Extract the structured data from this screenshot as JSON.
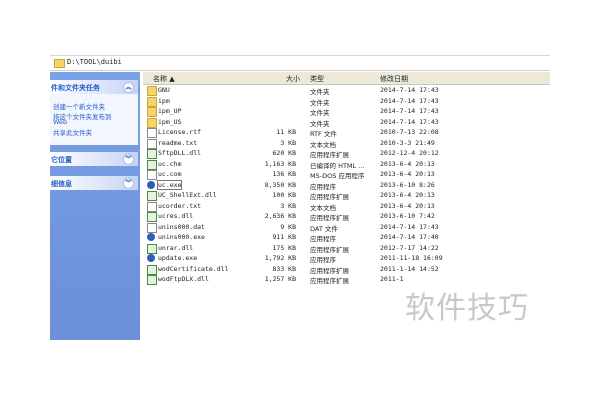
{
  "address": {
    "path": "D:\\TOOL\\duibi"
  },
  "left_panel": {
    "sections": [
      {
        "title": "件和文件夹任务",
        "items": [
          "创建一个新文件夹",
          "将这个文件夹发布到",
          "Web",
          "共享此文件夹"
        ]
      },
      {
        "title": "它位置",
        "items": []
      },
      {
        "title": "细信息",
        "items": []
      }
    ]
  },
  "columns": {
    "name": "名称 ▲",
    "size": "大小",
    "type": "类型",
    "date": "修改日期"
  },
  "files": [
    {
      "name": "GNU",
      "size": "",
      "type": "文件夹",
      "date": "2014-7-14 17:43",
      "icon": "folder"
    },
    {
      "name": "ipm",
      "size": "",
      "type": "文件夹",
      "date": "2014-7-14 17:43",
      "icon": "folder"
    },
    {
      "name": "ipm_UP",
      "size": "",
      "type": "文件夹",
      "date": "2014-7-14 17:43",
      "icon": "folder"
    },
    {
      "name": "ipm_US",
      "size": "",
      "type": "文件夹",
      "date": "2014-7-14 17:43",
      "icon": "folder"
    },
    {
      "name": "License.rtf",
      "size": "11 KB",
      "type": "RTF 文件",
      "date": "2010-7-13 22:08",
      "icon": "file"
    },
    {
      "name": "readme.txt",
      "size": "3 KB",
      "type": "文本文档",
      "date": "2010-3-3 21:49",
      "icon": "file"
    },
    {
      "name": "SftpDLL.dll",
      "size": "620 KB",
      "type": "应用程序扩展",
      "date": "2012-12-4 20:12",
      "icon": "dll"
    },
    {
      "name": "uc.chm",
      "size": "1,163 KB",
      "type": "已编译的 HTML ...",
      "date": "2013-6-4 20:13",
      "icon": "dll"
    },
    {
      "name": "uc.com",
      "size": "136 KB",
      "type": "MS-DOS 应用程序",
      "date": "2013-6-4 20:13",
      "icon": "file"
    },
    {
      "name": "uc.exe",
      "size": "8,350 KB",
      "type": "应用程序",
      "date": "2013-6-10 8:26",
      "icon": "exe"
    },
    {
      "name": "UC_ShellExt.dll",
      "size": "100 KB",
      "type": "应用程序扩展",
      "date": "2013-6-4 20:13",
      "icon": "dll"
    },
    {
      "name": "ucorder.txt",
      "size": "3 KB",
      "type": "文本文档",
      "date": "2013-6-4 20:13",
      "icon": "file"
    },
    {
      "name": "ucres.dll",
      "size": "2,636 KB",
      "type": "应用程序扩展",
      "date": "2013-6-10 7:42",
      "icon": "dll"
    },
    {
      "name": "unins000.dat",
      "size": "9 KB",
      "type": "DAT 文件",
      "date": "2014-7-14 17:43",
      "icon": "file"
    },
    {
      "name": "unins000.exe",
      "size": "911 KB",
      "type": "应用程序",
      "date": "2014-7-14 17:40",
      "icon": "exe"
    },
    {
      "name": "unrar.dll",
      "size": "175 KB",
      "type": "应用程序扩展",
      "date": "2012-7-17 14:22",
      "icon": "dll"
    },
    {
      "name": "update.exe",
      "size": "1,792 KB",
      "type": "应用程序",
      "date": "2011-11-18 16:09",
      "icon": "exe"
    },
    {
      "name": "wodCertificate.dll",
      "size": "833 KB",
      "type": "应用程序扩展",
      "date": "2011-1-14 14:52",
      "icon": "dll"
    },
    {
      "name": "wodFtpDLX.dll",
      "size": "1,257 KB",
      "type": "应用程序扩展",
      "date": "2011-1",
      "icon": "dll"
    }
  ],
  "watermark": "软件技巧"
}
